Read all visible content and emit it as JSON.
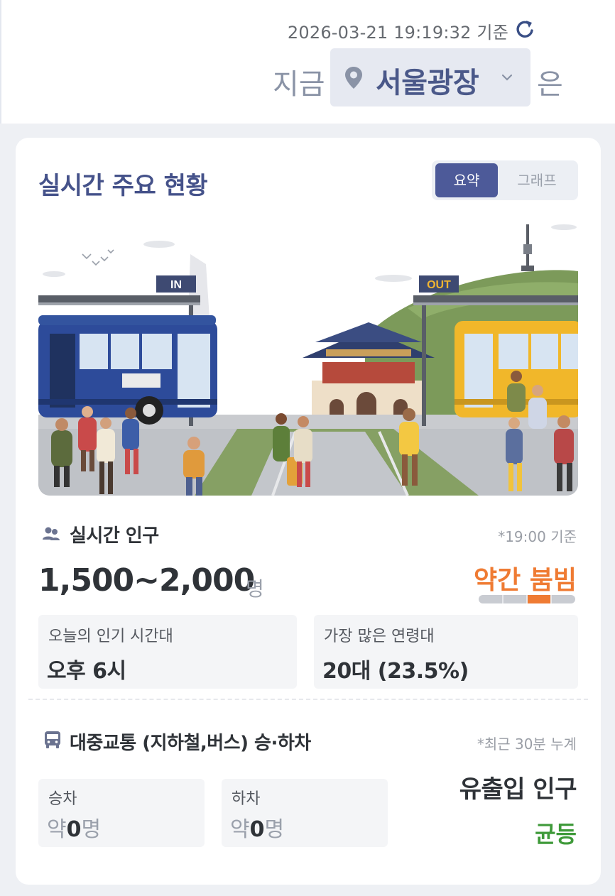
{
  "header": {
    "timestamp": "2026-03-21 19:19:32 기준",
    "now_word": "지금",
    "location": "서울광장",
    "suffix": "은"
  },
  "card": {
    "title": "실시간 주요 현황",
    "tabs": [
      {
        "label": "요약",
        "active": true
      },
      {
        "label": "그래프",
        "active": false
      }
    ],
    "illustration": {
      "sign_in": "IN",
      "sign_out": "OUT"
    }
  },
  "population": {
    "title": "실시간 인구",
    "note": "*19:00 기준",
    "range": "1,500~2,000",
    "unit": "명",
    "congestion_label": "약간 붐빔",
    "congestion_level": 3,
    "congestion_levels": 4,
    "stats": [
      {
        "label": "오늘의 인기 시간대",
        "value": "오후 6시"
      },
      {
        "label": "가장 많은 연령대",
        "value": "20대 (23.5%)"
      }
    ]
  },
  "transit": {
    "title": "대중교통 (지하철,버스) 승·하차",
    "note": "*최근 30분 누계",
    "boarding": {
      "label": "승차",
      "prefix": "약",
      "count": "0",
      "unit": "명"
    },
    "alighting": {
      "label": "하차",
      "prefix": "약",
      "count": "0",
      "unit": "명"
    },
    "flow_title": "유출입 인구",
    "flow_status": "균등"
  },
  "colors": {
    "accent": "#4d5a99",
    "congestion": "#ef7b33",
    "flow_status": "#3f9a3a"
  },
  "icons": {
    "refresh": "refresh-icon",
    "location": "pin-icon",
    "dropdown": "chevron-down-icon",
    "population": "people-icon",
    "transit": "bus-icon"
  }
}
